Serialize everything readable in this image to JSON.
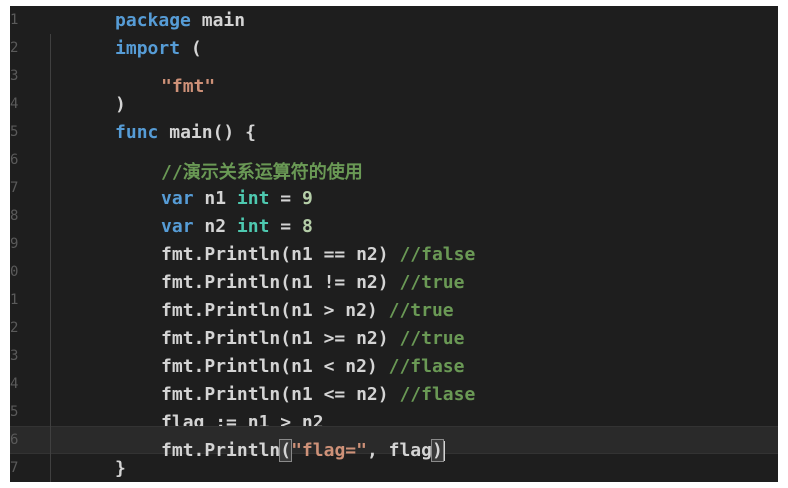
{
  "editor": {
    "colors": {
      "background": "#1e1e1e",
      "keyword": "#569cd6",
      "string": "#ce9178",
      "comment": "#6a9955",
      "number": "#b5cea8",
      "text": "#d4d4d4",
      "line_number": "#5a5a5a"
    },
    "line_numbers": [
      "1",
      "2",
      "3",
      "4",
      "5",
      "6",
      "7",
      "8",
      "9",
      "0",
      "1",
      "2",
      "3",
      "4",
      "5",
      "6",
      "7"
    ],
    "lines": [
      [
        "package",
        " main"
      ],
      [
        "import",
        " ("
      ],
      [
        "\"fmt\""
      ],
      [
        ")"
      ],
      [
        "func",
        " main() {"
      ],
      [
        "//演示关系运算符的使用"
      ],
      [
        "var",
        " n1 ",
        "int",
        " = ",
        "9"
      ],
      [
        "var",
        " n2 ",
        "int",
        " = ",
        "8"
      ],
      [
        "fmt.Println(n1 == n2) ",
        "//false"
      ],
      [
        "fmt.Println(n1 != n2) ",
        "//true"
      ],
      [
        "fmt.Println(n1 > n2) ",
        "//true"
      ],
      [
        "fmt.Println(n1 >= n2) ",
        "//true"
      ],
      [
        "fmt.Println(n1 < n2) ",
        "//flase"
      ],
      [
        "fmt.Println(n1 <= n2) ",
        "//flase"
      ],
      [
        "flag := n1 > n2"
      ],
      [
        "fmt.Println",
        "(",
        "\"flag=\"",
        ", flag",
        ")"
      ],
      [
        "}"
      ]
    ]
  }
}
